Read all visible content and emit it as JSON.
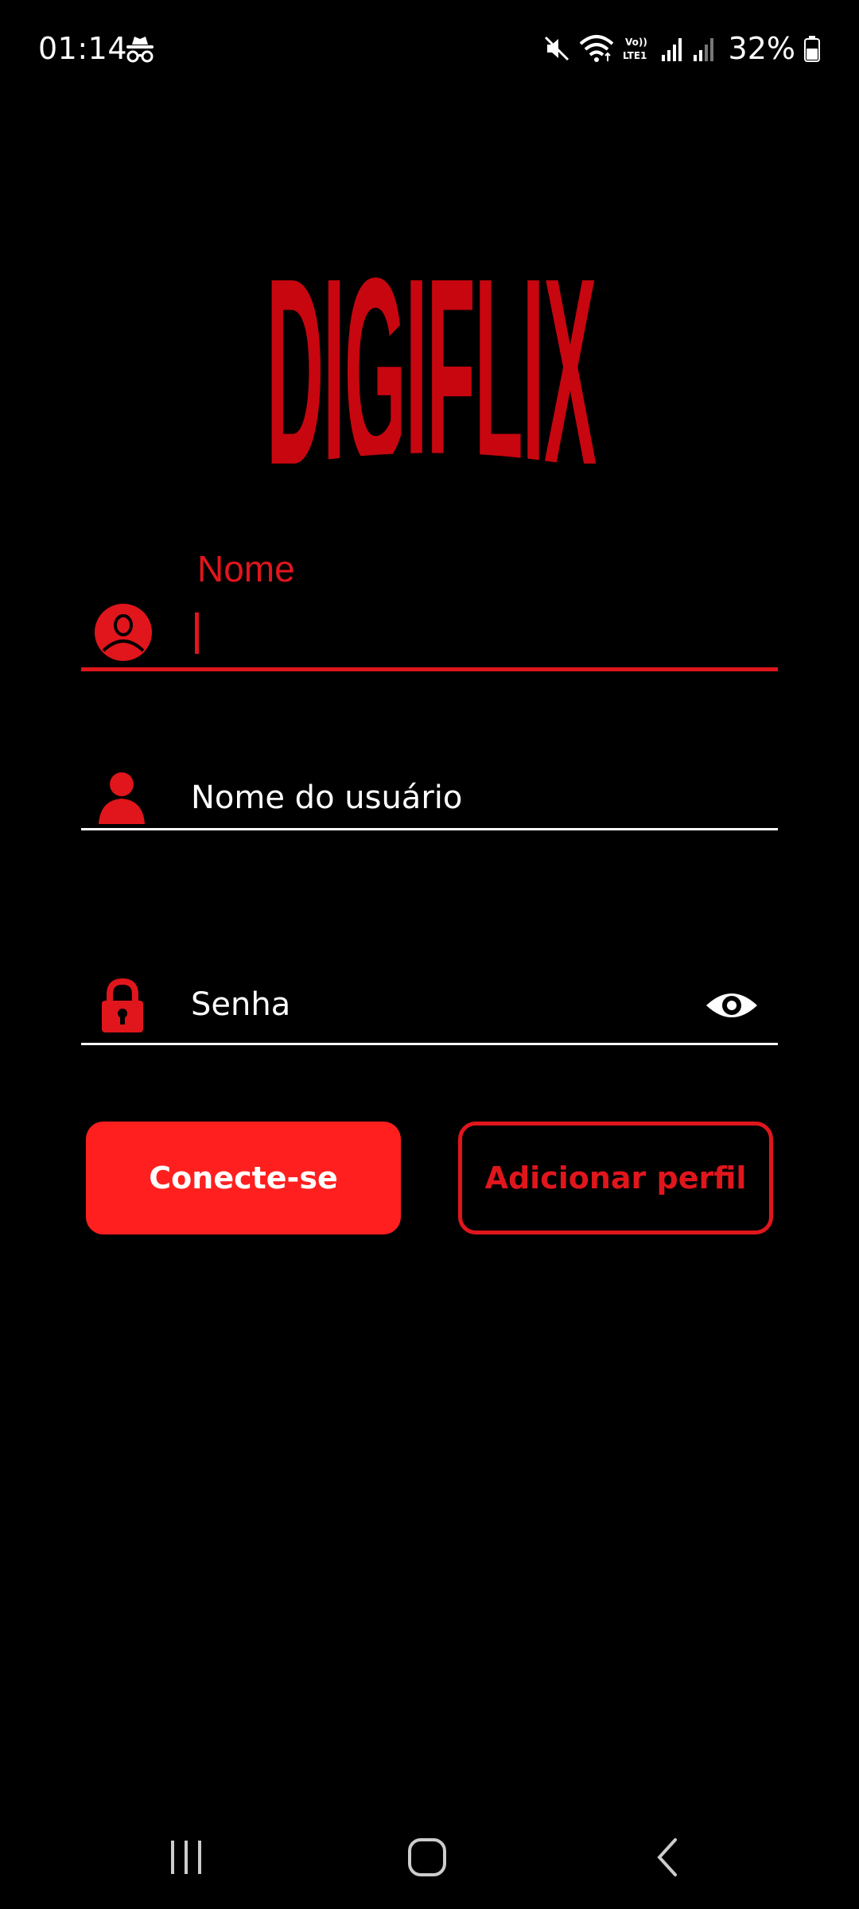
{
  "status_bar": {
    "time": "01:14",
    "battery": "32%",
    "icons": [
      "incognito-icon",
      "mute-icon",
      "wifi-icon",
      "volte-icon",
      "signal-icon",
      "signal-weak-icon",
      "battery-icon"
    ]
  },
  "app": {
    "logo_text": "DIGIFLIX",
    "brand_color": "#e0161c"
  },
  "form": {
    "name_field": {
      "label": "Nome",
      "value": "",
      "icon": "profile-circle-icon"
    },
    "username_field": {
      "placeholder": "Nome do usuário",
      "value": "",
      "icon": "person-icon"
    },
    "password_field": {
      "placeholder": "Senha",
      "value": "",
      "icon": "lock-icon",
      "toggle_icon": "eye-icon"
    }
  },
  "buttons": {
    "connect_label": "Conecte-se",
    "add_profile_label": "Adicionar perfil",
    "primary_color": "#ff1f1f"
  },
  "nav_bar": {
    "icons": [
      "recent-apps-icon",
      "home-icon",
      "back-icon"
    ]
  }
}
